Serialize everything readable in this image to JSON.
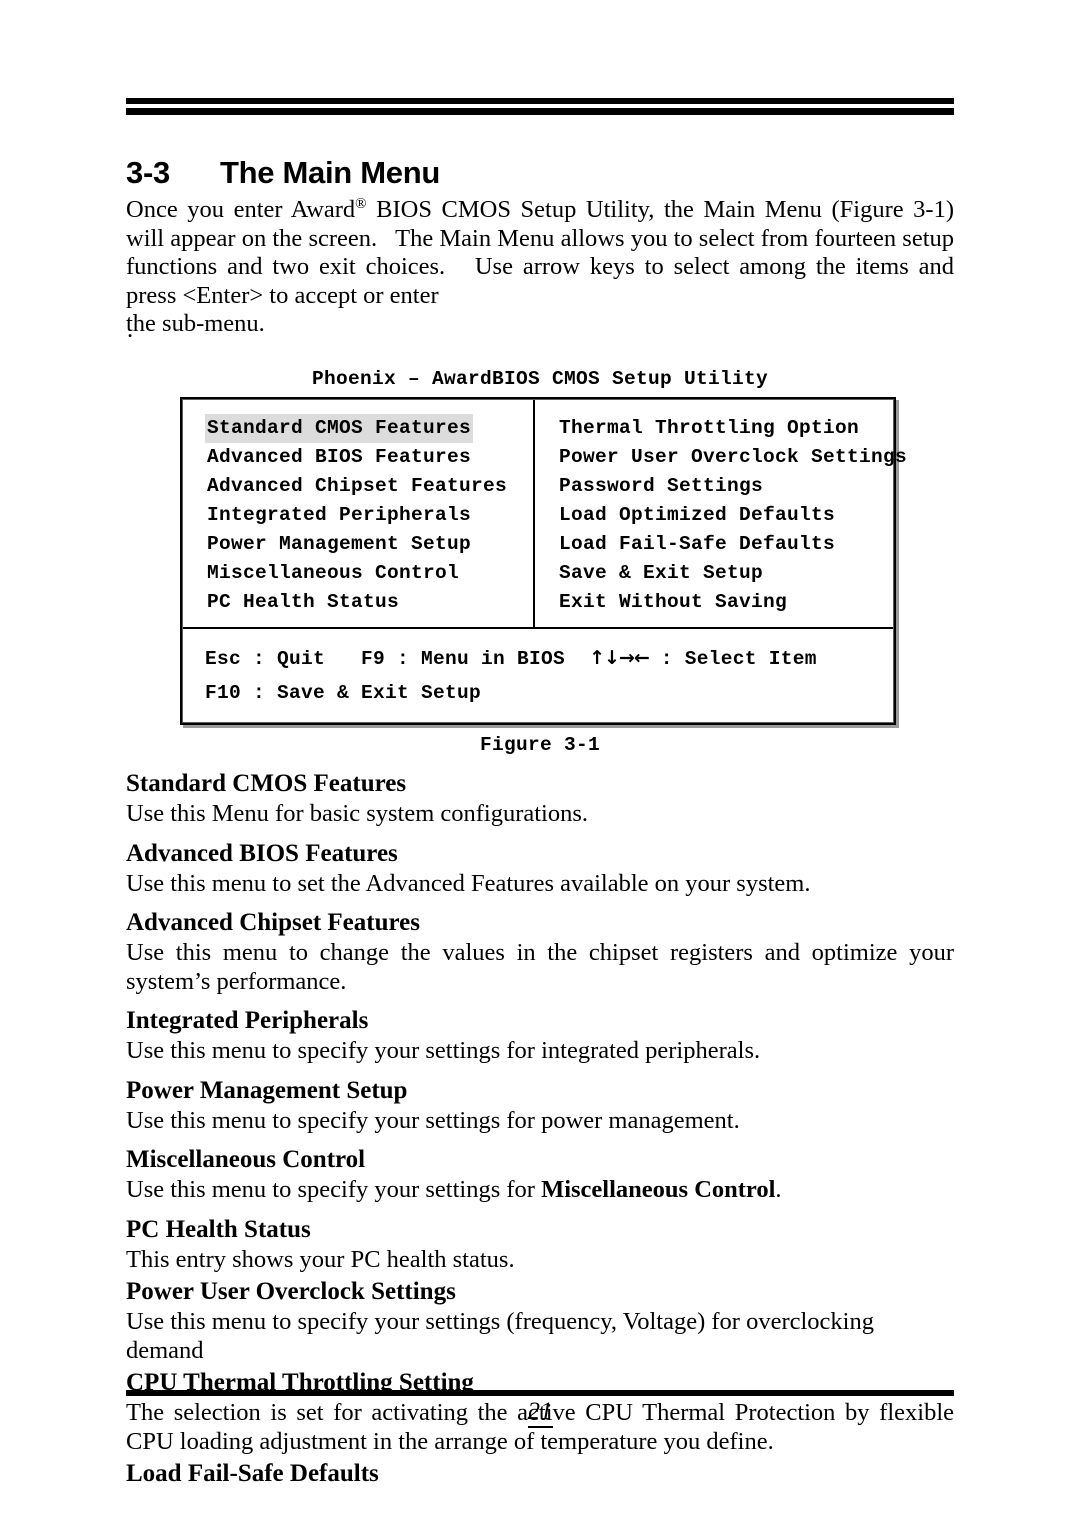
{
  "heading": {
    "number": "3-3",
    "title": "The Main Menu"
  },
  "intro": {
    "line1_pre": "Once you enter Award",
    "registered_mark": "®",
    "line1_post": " BIOS CMOS Setup Utility, the Main Menu (Figure 3-1) will appear on the screen.   The Main Menu allows you to select from fourteen setup functions and two exit choices.   Use arrow keys to select among the items and press <Enter> to accept or enter",
    "last_line": "the sub-menu.",
    "stray_period": "."
  },
  "bios": {
    "window_title": "Phoenix – AwardBIOS CMOS Setup Utility",
    "left_column": [
      {
        "label": "Standard CMOS Features",
        "selected": true
      },
      {
        "label": "Advanced BIOS Features",
        "selected": false
      },
      {
        "label": "Advanced Chipset Features",
        "selected": false
      },
      {
        "label": "Integrated Peripherals",
        "selected": false
      },
      {
        "label": "Power Management Setup",
        "selected": false
      },
      {
        "label": "Miscellaneous Control",
        "selected": false
      },
      {
        "label": "PC Health Status",
        "selected": false
      }
    ],
    "right_column": [
      {
        "label": "Thermal Throttling Option",
        "selected": false
      },
      {
        "label": "Power User Overclock Settings",
        "selected": false
      },
      {
        "label": "Password Settings",
        "selected": false
      },
      {
        "label": "Load Optimized Defaults",
        "selected": false
      },
      {
        "label": "Load Fail-Safe Defaults",
        "selected": false
      },
      {
        "label": "Save & Exit Setup",
        "selected": false
      },
      {
        "label": "Exit Without Saving",
        "selected": false
      }
    ],
    "key_help": {
      "line1_left": "Esc : Quit   F9 : Menu in BIOS  ",
      "arrows": "↑↓→←",
      "line1_right": " : Select Item",
      "line2": "F10 : Save & Exit Setup"
    },
    "selected_highlight_color": "#dcdcdc"
  },
  "figure_caption": "Figure 3-1",
  "descriptions": [
    {
      "head": "Standard CMOS Features",
      "body": "Use this Menu for basic system configurations."
    },
    {
      "head": "Advanced BIOS Features",
      "body": "Use this menu to set the Advanced Features available on your system."
    },
    {
      "head": "Advanced Chipset Features",
      "body": "Use this menu to change the values in the chipset registers and optimize your system’s performance."
    },
    {
      "head": "Integrated Peripherals",
      "body": "Use this menu to specify your settings for integrated peripherals."
    },
    {
      "head": "Power Management Setup",
      "body": "Use this menu to specify your settings for power management."
    },
    {
      "head": "Miscellaneous Control",
      "body_pre": "Use this menu to specify your settings for ",
      "body_bold": "Miscellaneous Control",
      "body_post": "."
    },
    {
      "head": "PC Health Status",
      "body": "This entry shows your PC health status."
    },
    {
      "head": "Power User Overclock Settings",
      "body": "Use this menu to specify your settings (frequency, Voltage) for overclocking demand"
    },
    {
      "head": "CPU Thermal Throttling Setting",
      "body": "The selection is set for activating the active CPU Thermal Protection by flexible CPU loading adjustment in the arrange of temperature you define."
    },
    {
      "head": "Load Fail-Safe Defaults",
      "body": ""
    }
  ],
  "footer": {
    "page_number": "21"
  }
}
